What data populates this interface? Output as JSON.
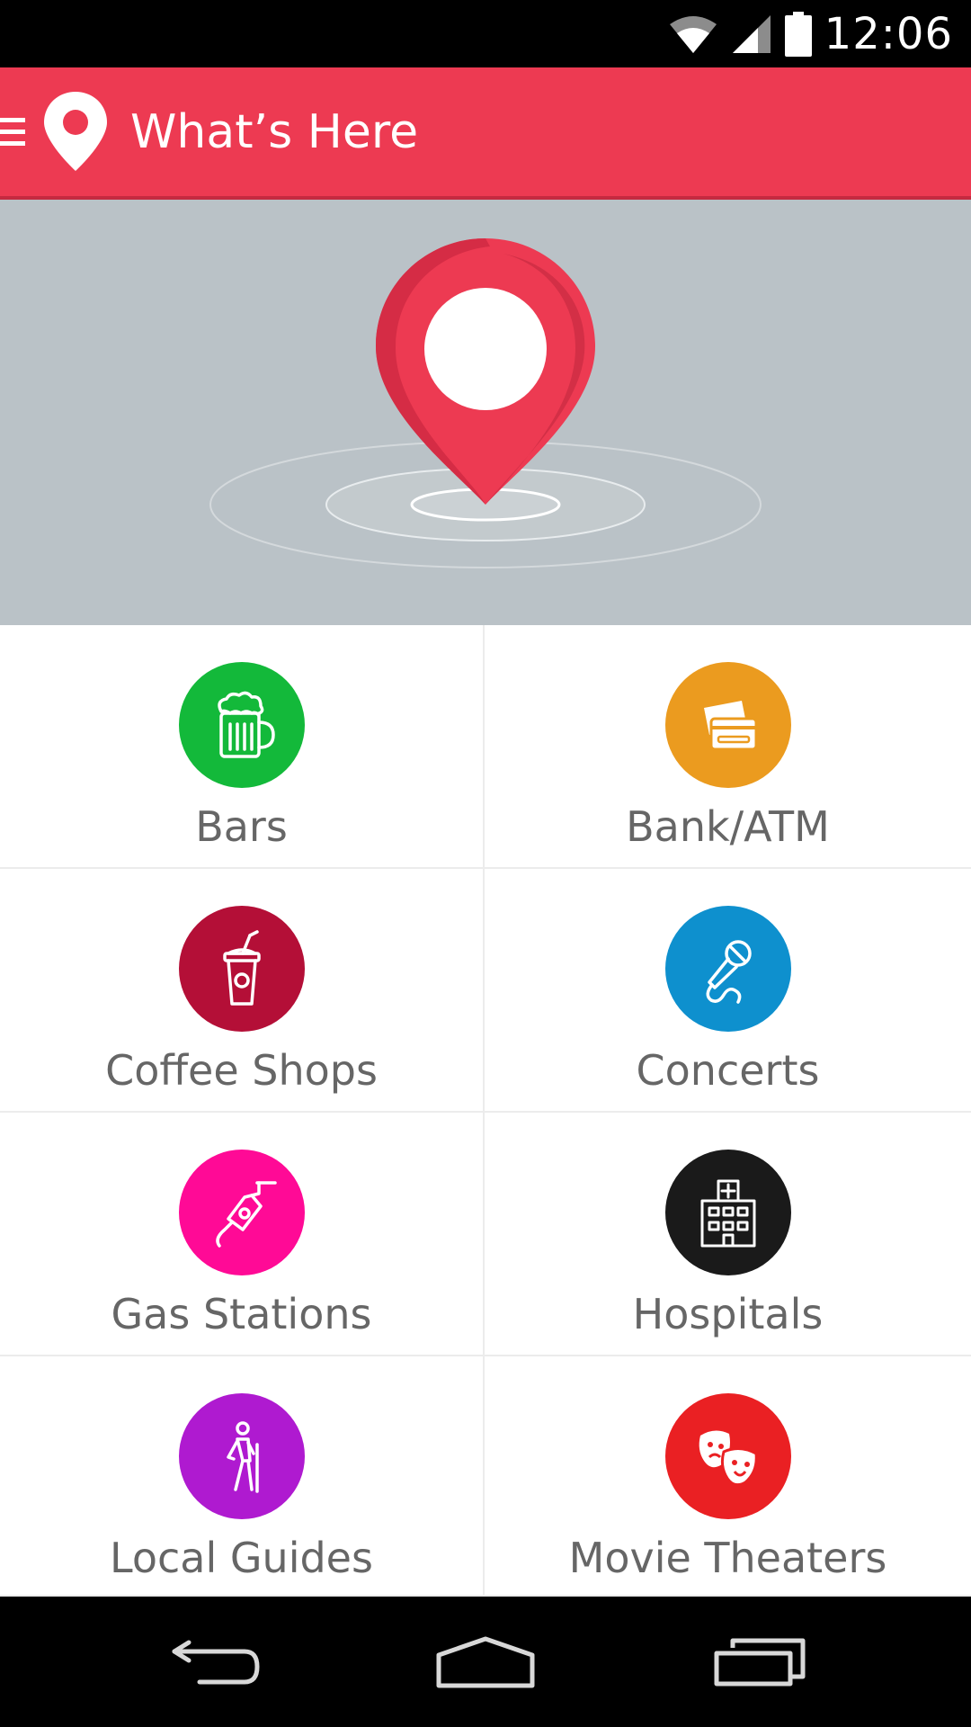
{
  "status_bar": {
    "time": "12:06",
    "icons": [
      "wifi-icon",
      "signal-icon",
      "battery-icon"
    ]
  },
  "app_bar": {
    "title": "What’s Here",
    "menu_icon": "menu-icon",
    "logo_icon": "map-pin-icon",
    "color": "#ED3A52"
  },
  "hero": {
    "background": "#BAC2C7",
    "icon": "location-pin-icon"
  },
  "categories": [
    {
      "label": "Bars",
      "icon": "beer-mug-icon",
      "color": "#13B93A"
    },
    {
      "label": "Bank/ATM",
      "icon": "credit-card-icon",
      "color": "#EB9B1F"
    },
    {
      "label": "Coffee Shops",
      "icon": "coffee-cup-icon",
      "color": "#B40F37"
    },
    {
      "label": "Concerts",
      "icon": "microphone-icon",
      "color": "#0E90CE"
    },
    {
      "label": "Gas Stations",
      "icon": "fuel-nozzle-icon",
      "color": "#FF0A96"
    },
    {
      "label": "Hospitals",
      "icon": "hospital-icon",
      "color": "#1A1A1A"
    },
    {
      "label": "Local Guides",
      "icon": "hiker-icon",
      "color": "#AF1AD0"
    },
    {
      "label": "Movie Theaters",
      "icon": "theater-masks-icon",
      "color": "#EA2023"
    }
  ],
  "nav_bar": {
    "buttons": [
      "back-icon",
      "home-icon",
      "recents-icon"
    ]
  }
}
